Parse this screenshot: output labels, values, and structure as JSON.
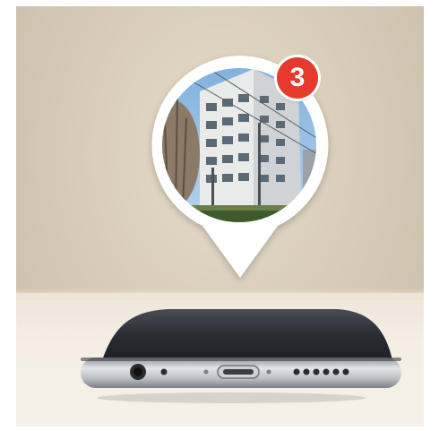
{
  "notification": {
    "count": "3"
  },
  "colors": {
    "badge": "#e63a2e",
    "bubble": "#ffffff",
    "phone_body": "#2c2f36",
    "phone_edge": "#c4c7cc"
  },
  "icons": {
    "bubble": "speech-bubble-pin-icon",
    "headphone_jack": "headphone-jack-icon",
    "port": "lightning-port-icon",
    "speaker": "speaker-grille-icon"
  }
}
